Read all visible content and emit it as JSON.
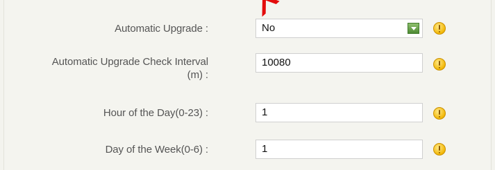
{
  "form": {
    "rows": [
      {
        "label": "Automatic Upgrade :",
        "type": "select",
        "value": "No"
      },
      {
        "label_line1": "Automatic Upgrade Check Interval",
        "label_line2": "(m) :",
        "type": "input",
        "value": "10080"
      },
      {
        "label": "Hour of the Day(0-23) :",
        "type": "input",
        "value": "1"
      },
      {
        "label": "Day of the Week(0-6) :",
        "type": "input",
        "value": "1"
      }
    ]
  },
  "icons": {
    "select_arrow": "chevron-down-icon",
    "info": "exclamation-info-icon"
  },
  "colors": {
    "background": "#f4f4ef",
    "label_text": "#555555",
    "field_border": "#cfcfcf",
    "select_arrow": "#4e8a34",
    "info_icon": "#f2b705",
    "watermark": "#e30000"
  },
  "watermark": {
    "text": "x-P."
  }
}
